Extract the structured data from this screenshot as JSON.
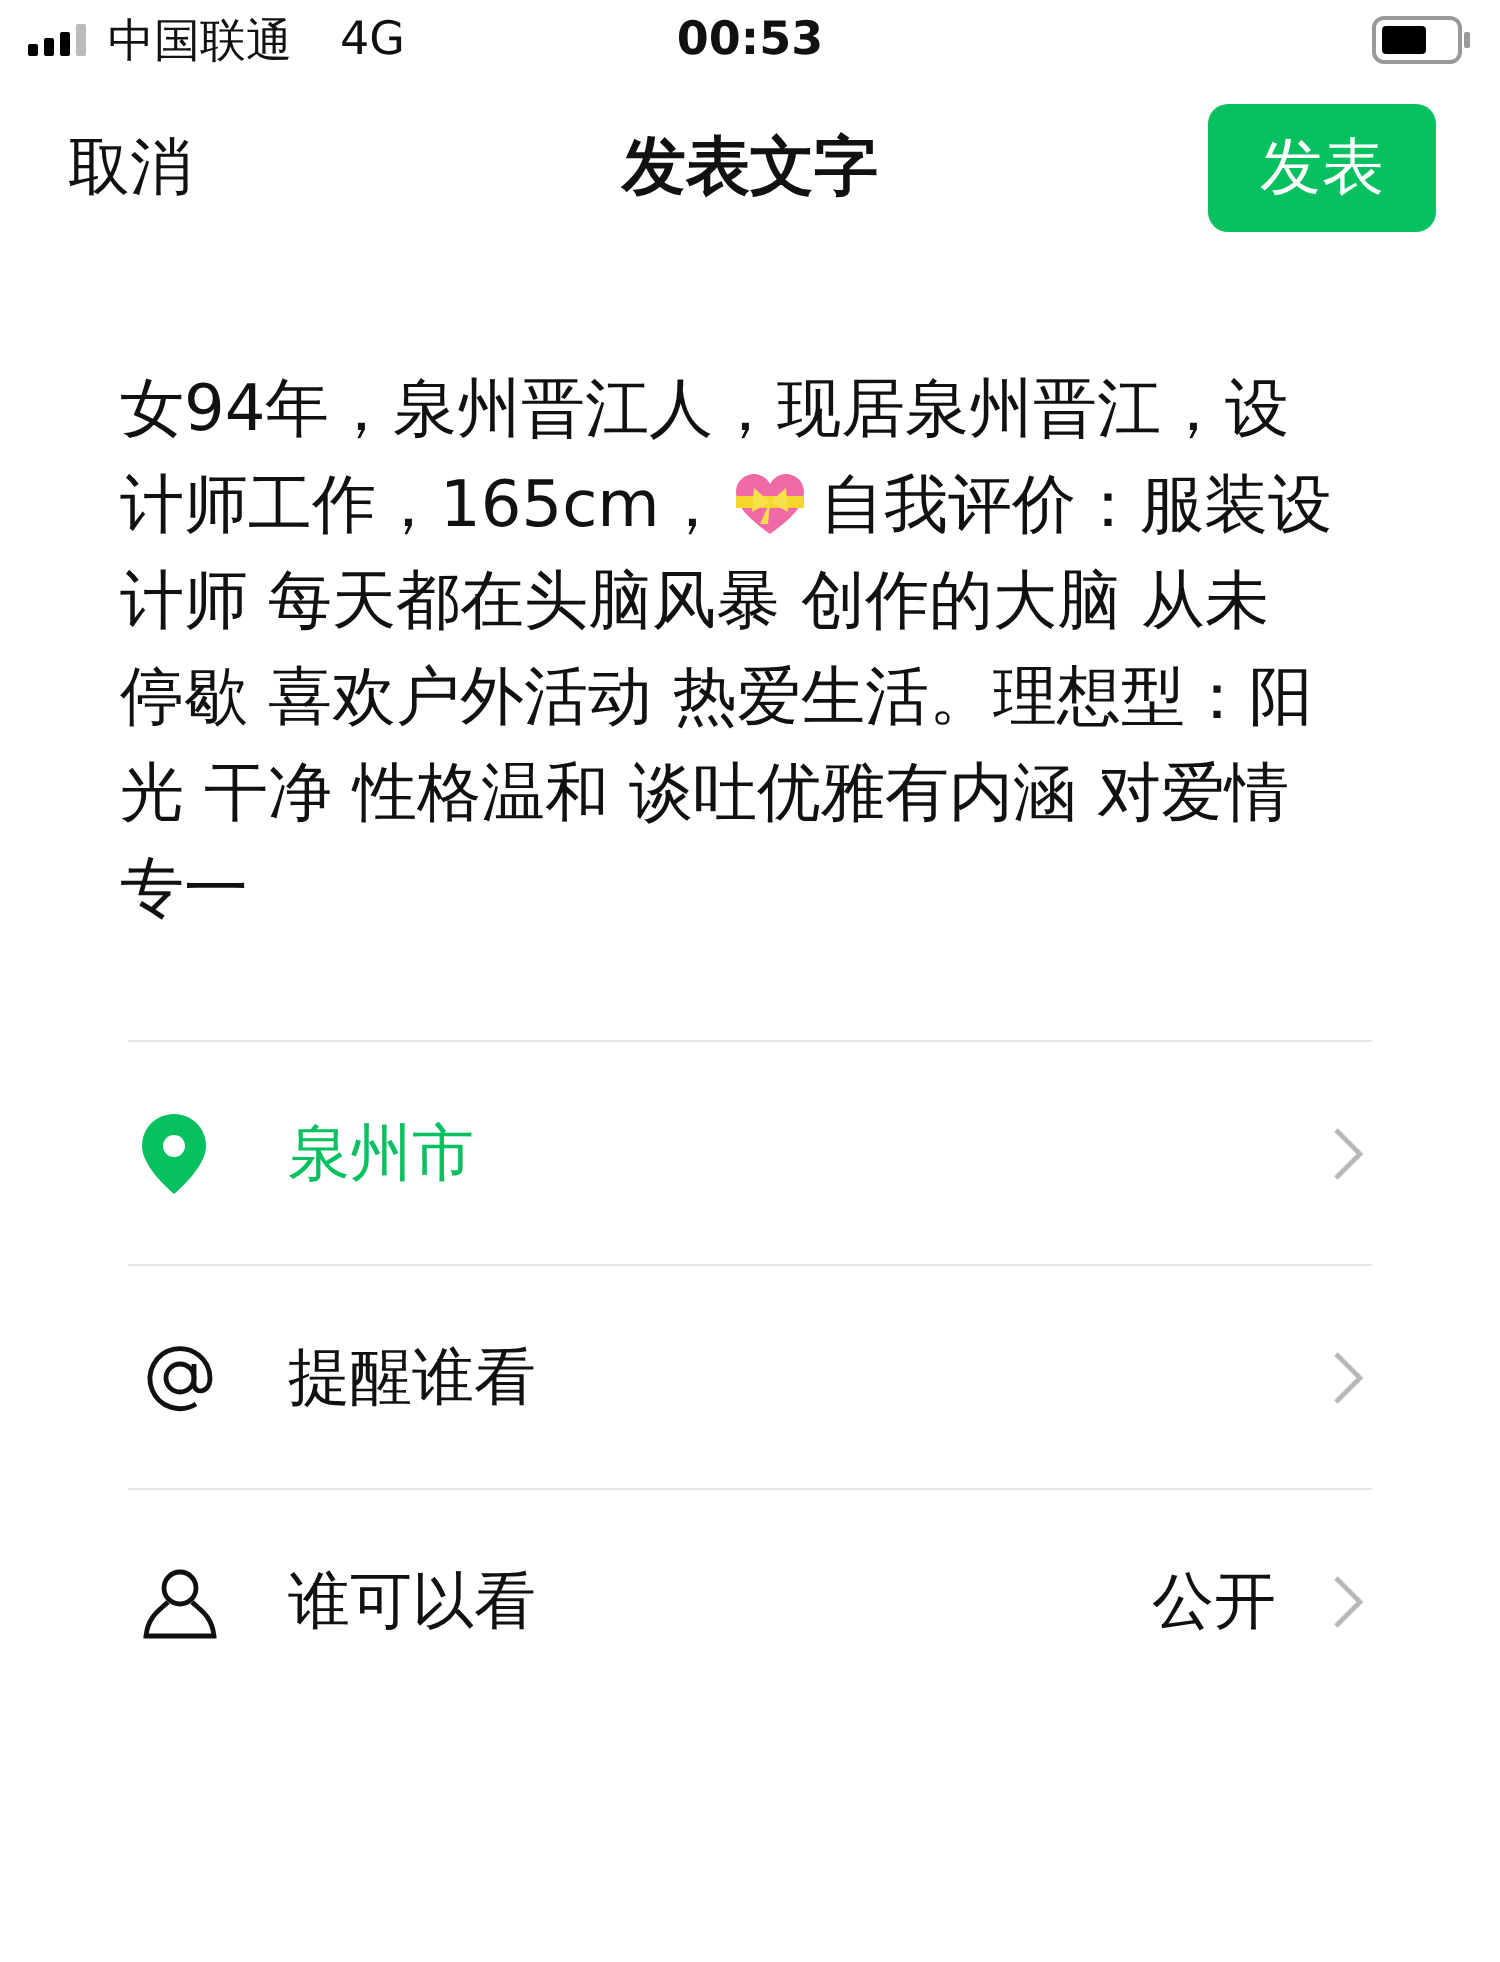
{
  "status_bar": {
    "carrier": "中国联通",
    "network": "4G",
    "time": "00:53"
  },
  "nav": {
    "cancel": "取消",
    "title": "发表文字",
    "publish": "发表"
  },
  "post": {
    "lines": [
      {
        "parts": [
          "女94年，泉州晋江人，现居泉州晋江，设"
        ]
      },
      {
        "parts": [
          "计师工作，165cm，",
          "自我评价：服装设"
        ]
      },
      {
        "parts": [
          "计师 每天都在头脑风暴 创作的大脑 从未"
        ]
      },
      {
        "parts": [
          "停歇 喜欢户外活动 热爱生活。理想型：阳"
        ]
      },
      {
        "parts": [
          "光 干净 性格温和 谈吐优雅有内涵 对爱情"
        ]
      },
      {
        "parts": [
          "专一"
        ]
      }
    ]
  },
  "options": [
    {
      "kind": "location",
      "label": "泉州市",
      "highlighted": true
    },
    {
      "kind": "mention",
      "label": "提醒谁看",
      "highlighted": false
    },
    {
      "kind": "visibility",
      "label": "谁可以看",
      "value": "公开",
      "highlighted": false
    }
  ]
}
